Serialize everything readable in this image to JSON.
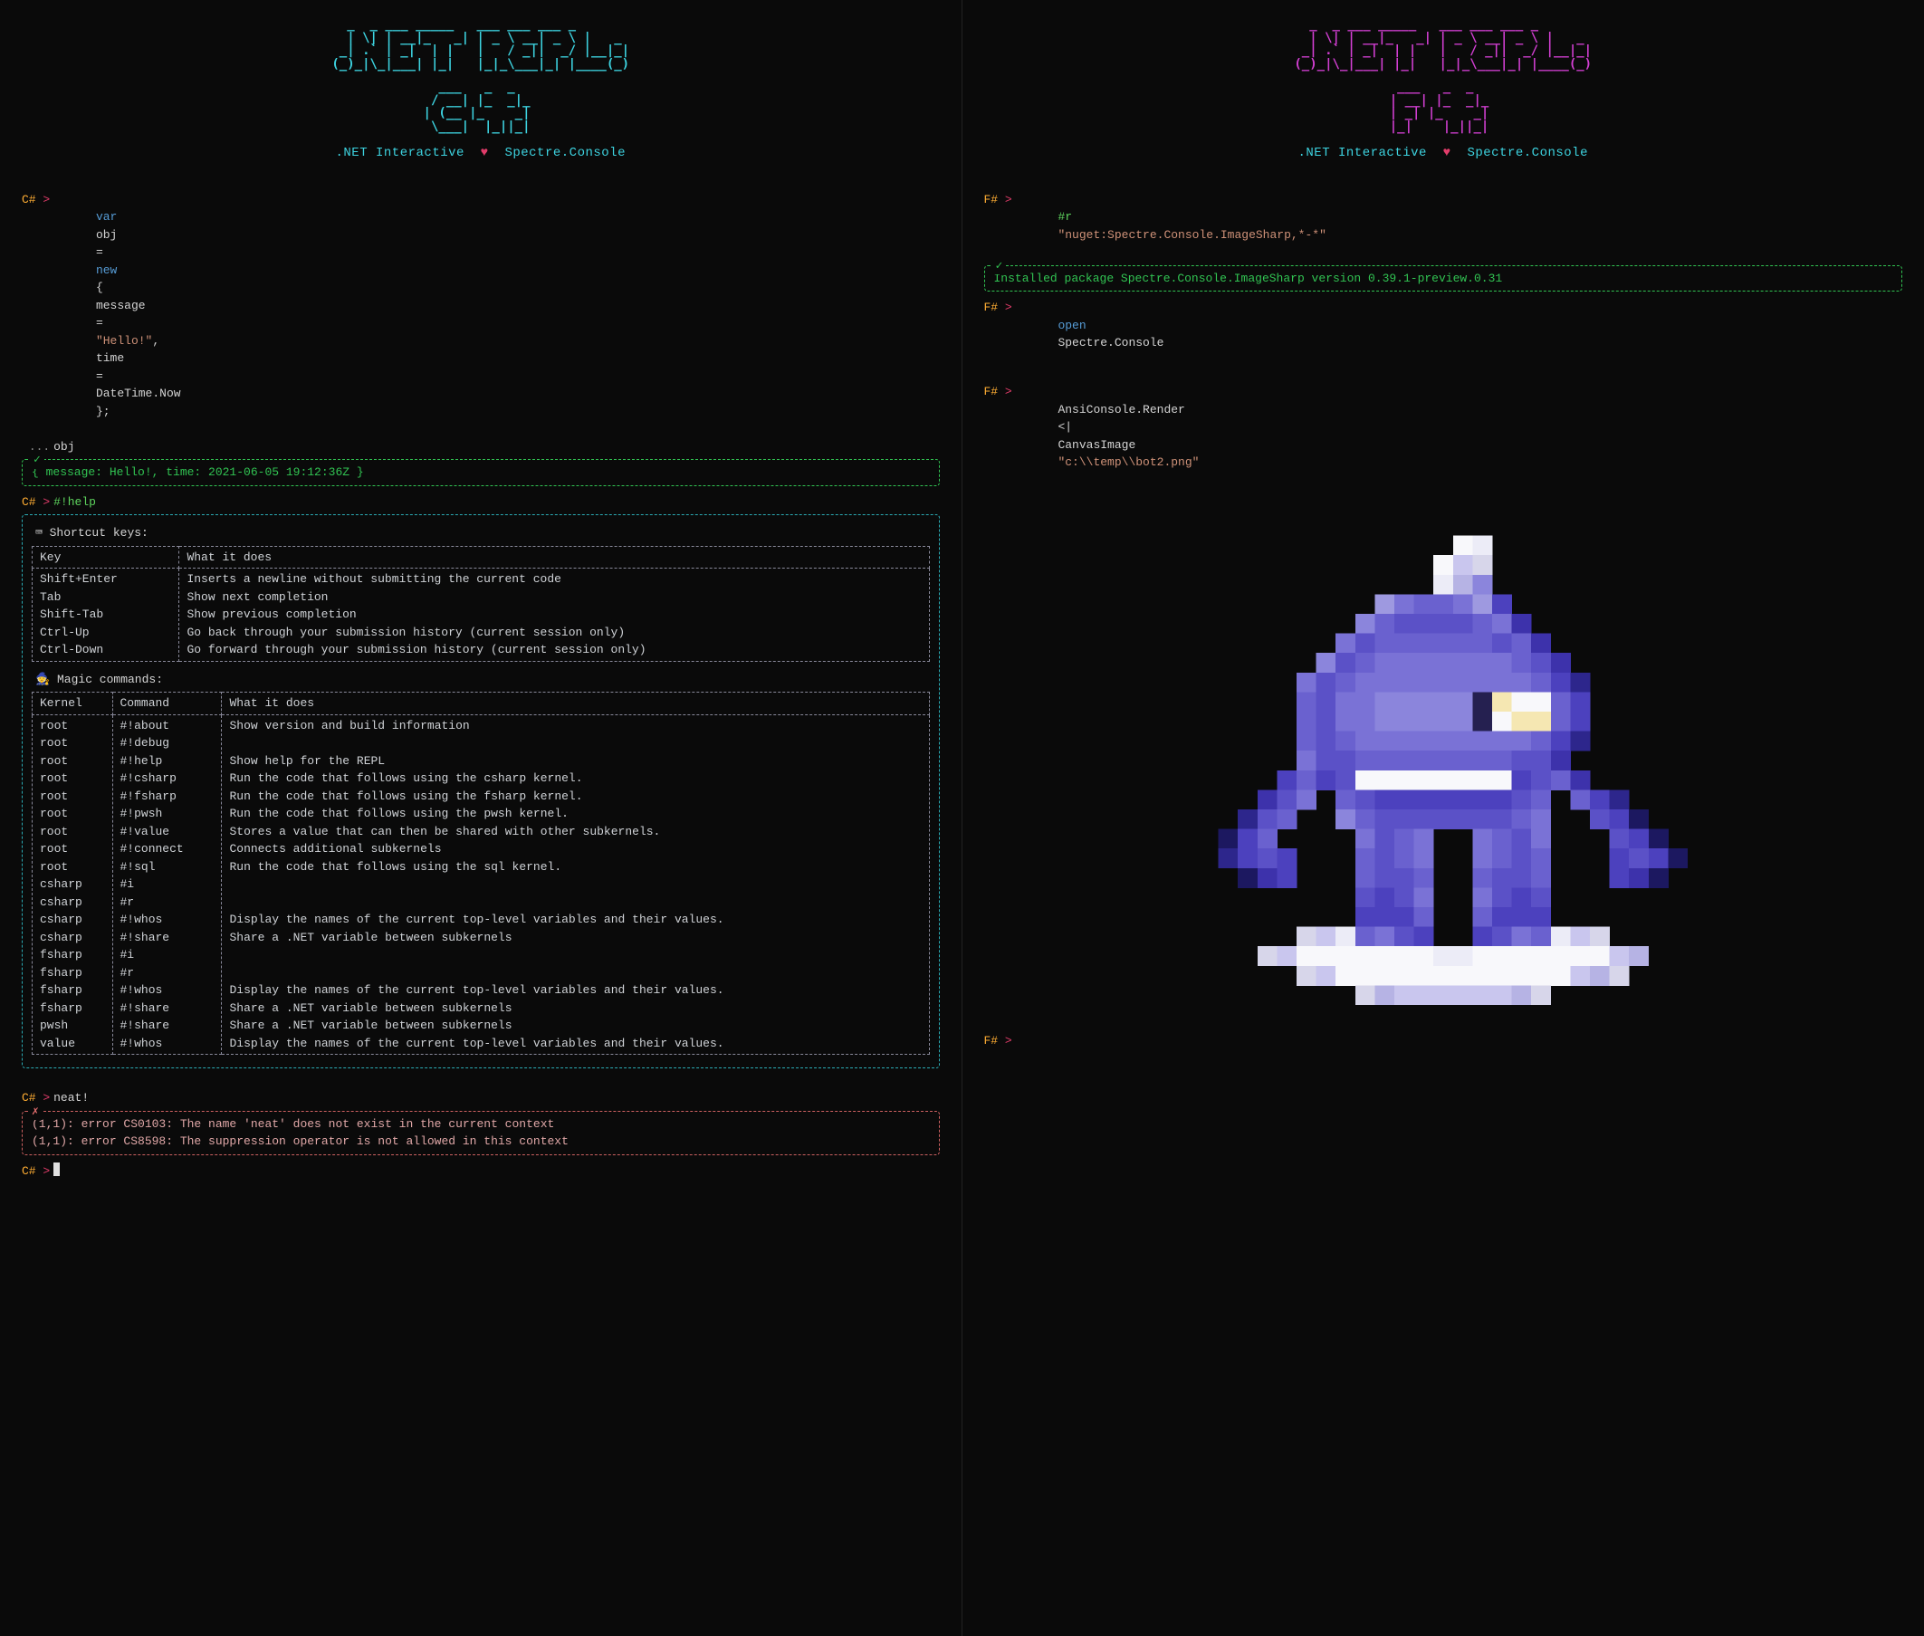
{
  "left": {
    "banner1": "   _  _ ___ _____   ___ ___ ___ _       \n   | \\| | __|_   _| | _ \\ __| _ \\ |   _  \n  _| .` | _|  | |   |   / _||  _/ |__|_| \n (_)_|\\_|___| |_|   |_|_\\___|_| |____(_) ",
    "banner2": "  ___   _  _   \n / __| |_  _|_ \n| (__ |_    _|\n \\___|  |_||_|",
    "subtitle_a": ".NET Interactive",
    "subtitle_h": "♥",
    "subtitle_b": "Spectre.Console",
    "prompt": "C#",
    "cmd1": {
      "kw_var": "var",
      "name": "obj",
      "eq": "=",
      "kw_new": "new",
      "brace_open": "{",
      "msg_key": "message",
      "msg_val": "\"Hello!\"",
      "time_key": "time",
      "time_val": "DateTime",
      "time_now": "Now",
      "brace_close": "};",
      "cont": "...",
      "cont_body": "obj"
    },
    "out1": "{ message: Hello!, time: 2021-06-05 19:12:36Z }",
    "cmd2": "#!help",
    "shortcut_header": "⌨  Shortcut keys:",
    "shortcut_cols": [
      "Key",
      "What it does"
    ],
    "shortcut_rows": [
      [
        "Shift+Enter",
        "Inserts a newline without submitting the current code"
      ],
      [
        "Tab",
        "Show next completion"
      ],
      [
        "Shift-Tab",
        "Show previous completion"
      ],
      [
        "Ctrl-Up",
        "Go back through your submission history (current session only)"
      ],
      [
        "Ctrl-Down",
        "Go forward through your submission history (current session only)"
      ]
    ],
    "magic_header": "🧙  Magic commands:",
    "magic_cols": [
      "Kernel",
      "Command",
      "What it does"
    ],
    "magic_rows": [
      [
        "root",
        "#!about",
        "Show version and build information"
      ],
      [
        "root",
        "#!debug",
        ""
      ],
      [
        "root",
        "#!help",
        "Show help for the REPL"
      ],
      [
        "root",
        "#!csharp",
        "Run the code that follows using the csharp kernel."
      ],
      [
        "root",
        "#!fsharp",
        "Run the code that follows using the fsharp kernel."
      ],
      [
        "root",
        "#!pwsh",
        "Run the code that follows using the pwsh kernel."
      ],
      [
        "root",
        "#!value",
        "Stores a value that can then be shared with other subkernels."
      ],
      [
        "root",
        "#!connect",
        "Connects additional subkernels"
      ],
      [
        "root",
        "#!sql",
        "Run the code that follows using the sql kernel."
      ],
      [
        "csharp",
        "#i",
        ""
      ],
      [
        "csharp",
        "#r",
        ""
      ],
      [
        "csharp",
        "#!whos",
        "Display the names of the current top-level variables and their values."
      ],
      [
        "csharp",
        "#!share",
        "Share a .NET variable between subkernels"
      ],
      [
        "fsharp",
        "#i",
        ""
      ],
      [
        "fsharp",
        "#r",
        ""
      ],
      [
        "fsharp",
        "#!whos",
        "Display the names of the current top-level variables and their values."
      ],
      [
        "fsharp",
        "#!share",
        "Share a .NET variable between subkernels"
      ],
      [
        "pwsh",
        "#!share",
        "Share a .NET variable between subkernels"
      ],
      [
        "value",
        "#!whos",
        "Display the names of the current top-level variables and their values."
      ]
    ],
    "cmd3": "neat!",
    "err1": "(1,1): error CS0103: The name 'neat' does not exist in the current context",
    "err2": "(1,1): error CS8598: The suppression operator is not allowed in this context"
  },
  "right": {
    "banner1": "   _  _ ___ _____   ___ ___ ___ _       \n   | \\| | __|_   _| | _ \\ __| _ \\ |   _  \n  _| .` | _|  | |   |   / _||  _/ |__|_| \n (_)_|\\_|___| |_|   |_|_\\___|_| |____(_) ",
    "banner2": " ___   _  _   \n| __| |_  _|_ \n| _| |_    _|\n|_|    |_||_|",
    "subtitle_a": ".NET Interactive",
    "subtitle_h": "♥",
    "subtitle_b": "Spectre.Console",
    "prompt": "F#",
    "cmd1_a": "#r",
    "cmd1_b": "\"nuget:Spectre.Console.ImageSharp,*-*\"",
    "out1": "Installed package Spectre.Console.ImageSharp version 0.39.1-preview.0.31",
    "cmd2_a": "open",
    "cmd2_b": "Spectre.Console",
    "cmd3_a": "AnsiConsole.Render",
    "cmd3_op": "<|",
    "cmd3_b": "CanvasImage",
    "cmd3_c": "\"c:\\\\temp\\\\bot2.png\"",
    "pixel_art": {
      "note": "rendered canvas image of a purple ninja bot",
      "width": 25,
      "height": 25,
      "palette": {
        ".": "transparent",
        "A": "#ececf7",
        "B": "#d7d6ea",
        "C": "#b6b3e4",
        "D": "#9e99e0",
        "E": "#8b85dc",
        "F": "#7a72d6",
        "G": "#6a61cf",
        "H": "#5b51c7",
        "I": "#4c41be",
        "J": "#3d32ab",
        "K": "#2d268c",
        "L": "#1c1860",
        "W": "#f8f8fb",
        "Y": "#f5e7b2",
        "M": "#252050",
        "N": "#c9c6ee"
      },
      "rows": [
        ".........................",
        ".............WA..........",
        "............WNB..........",
        "............ACE..........",
        ".........DFGGFDI.........",
        "........EGHHHHGFJ........",
        ".......FHGGGGGGHGJ.......",
        "......EHGFFFFFFFGHJ......",
        ".....FHGFFFFFFFFFGIK.....",
        ".....GHFFEEEEEMYWWGI.....",
        ".....GHFFEEEEEMWYYGI.....",
        ".....GHGFFFFFFFFFGIK.....",
        ".....FHHGGGGGGGGHHJ......",
        "....IGIHWWWWWWWWIHGJ.....",
        "...JHF.GHIIIIIIIHG.GIK...",
        "..KHG..EGHHHHHHHGF..HIL..",
        ".LIG....FHGF..FGHF...HIL.",
        ".KIHI...GHGF..FGHG...IHIL",
        "..LJI...GHHG..GHHG...IJL.",
        "........HIHF..FHIH.......",
        "........IIIG..GIII.......",
        ".....BNAGFHI..IHFGANB....",
        "...BNWWWWWWWAAWWWWWWWNC..",
        ".....BNWWWWWWWWWWWWNCB...",
        "........BCNNNNNNCB......."
      ]
    }
  }
}
